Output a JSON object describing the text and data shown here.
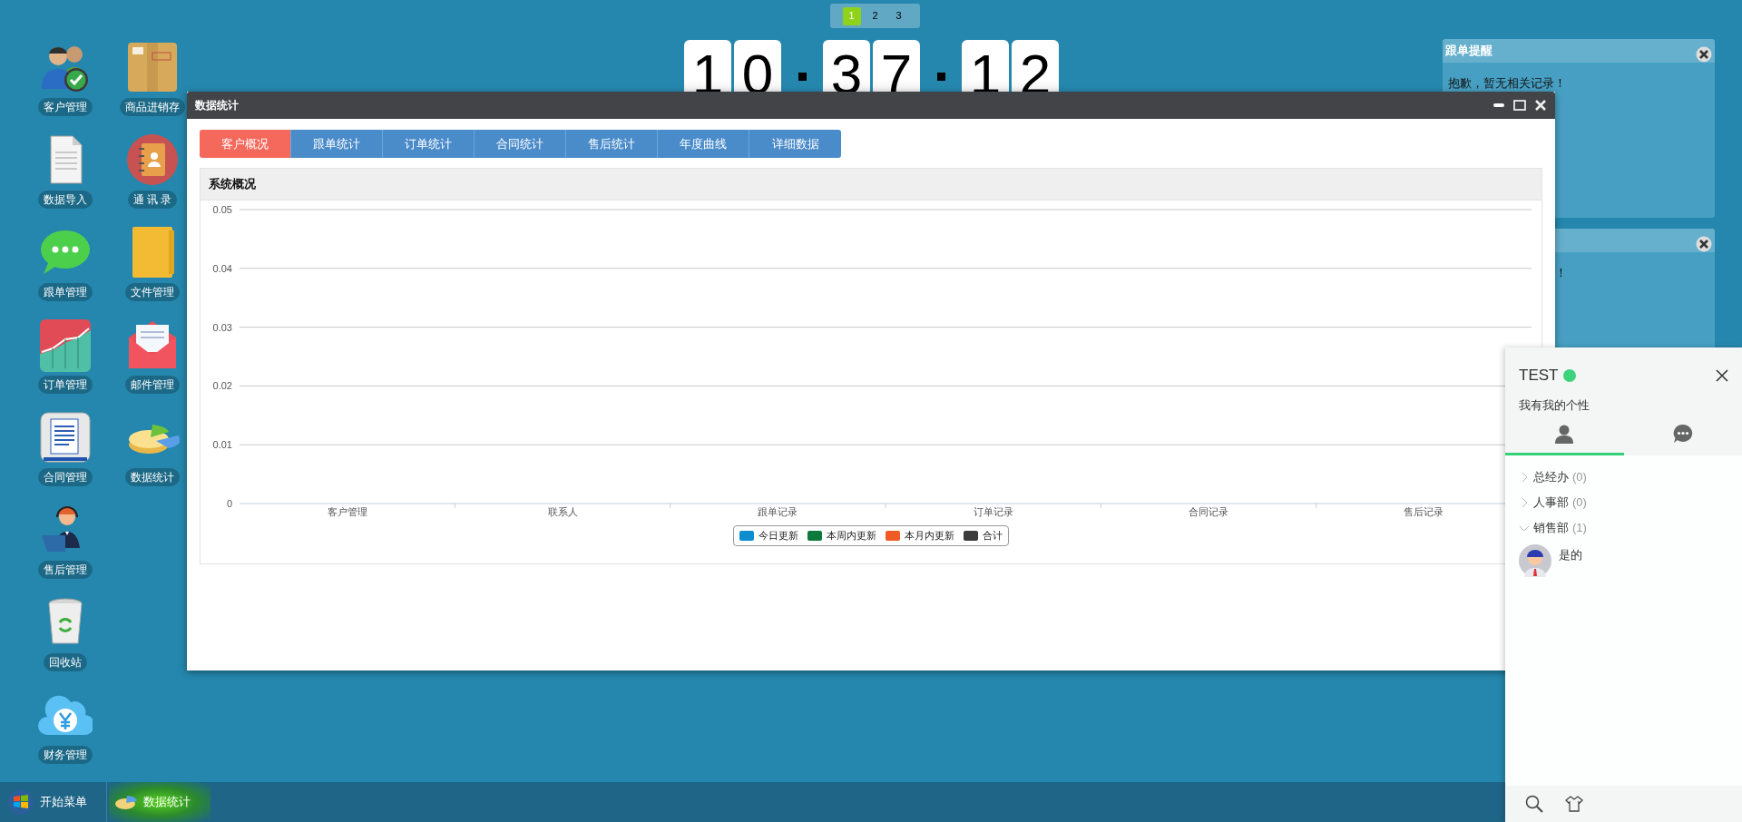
{
  "desktop_columns": [
    {
      "icons": [
        {
          "label": "客户管理"
        },
        {
          "label": "数据导入"
        },
        {
          "label": "跟单管理"
        },
        {
          "label": "订单管理"
        },
        {
          "label": "合同管理"
        },
        {
          "label": "售后管理"
        },
        {
          "label": "回收站"
        },
        {
          "label": "财务管理"
        }
      ]
    },
    {
      "icons": [
        {
          "label": "商品进销存"
        },
        {
          "label": "通 讯 录"
        },
        {
          "label": "文件管理"
        },
        {
          "label": "邮件管理"
        },
        {
          "label": "数据统计"
        }
      ]
    }
  ],
  "pager": [
    {
      "label": "1",
      "selected": true
    },
    {
      "label": "2",
      "selected": false
    },
    {
      "label": "3",
      "selected": false
    }
  ],
  "clock": {
    "digits": [
      "1",
      "0",
      "3",
      "7",
      "1",
      "2"
    ]
  },
  "window": {
    "title": "数据统计",
    "tabs": [
      {
        "label": "客户概况",
        "selected": true
      },
      {
        "label": "跟单统计",
        "selected": false
      },
      {
        "label": "订单统计",
        "selected": false
      },
      {
        "label": "合同统计",
        "selected": false
      },
      {
        "label": "售后统计",
        "selected": false
      },
      {
        "label": "年度曲线",
        "selected": false
      },
      {
        "label": "详细数据",
        "selected": false
      }
    ],
    "panel": {
      "title": "系统概况",
      "chart_data": {
        "type": "bar",
        "grid": true,
        "categories": [
          "客户管理",
          "联系人",
          "跟单记录",
          "订单记录",
          "合同记录",
          "售后记录"
        ],
        "ylim": [
          0,
          0.05
        ],
        "yticks": [
          {
            "value": 0,
            "label": "0"
          },
          {
            "value": 0.01,
            "label": "0.01"
          },
          {
            "value": 0.02,
            "label": "0.02"
          },
          {
            "value": 0.03,
            "label": "0.03"
          },
          {
            "value": 0.04,
            "label": "0.04"
          },
          {
            "value": 0.05,
            "label": "0.05"
          }
        ],
        "series": [
          {
            "name": "今日更新",
            "color": "#0e8ecf",
            "values": [
              0,
              0,
              0,
              0,
              0,
              0
            ]
          },
          {
            "name": "本周内更新",
            "color": "#0d7a3b",
            "values": [
              0,
              0,
              0,
              0,
              0,
              0
            ]
          },
          {
            "name": "本月内更新",
            "color": "#f05a24",
            "values": [
              0,
              0,
              0,
              0,
              0,
              0
            ]
          },
          {
            "name": "合计",
            "color": "#3d3b3c",
            "values": [
              0,
              0,
              0,
              0,
              0,
              0
            ]
          }
        ]
      }
    }
  },
  "reminders": [
    {
      "title": "跟单提醒",
      "message": "抱歉，暂无相关记录！"
    },
    {
      "message": "！"
    }
  ],
  "chat": {
    "name": "TEST",
    "online": true,
    "signature": "我有我的个性",
    "tabs": [
      {
        "selected": true
      },
      {
        "selected": false
      }
    ],
    "groups": [
      {
        "name": "总经办",
        "count": "(0)",
        "expanded": false
      },
      {
        "name": "人事部",
        "count": "(0)",
        "expanded": false
      },
      {
        "name": "销售部",
        "count": "(1)",
        "expanded": true,
        "children": [
          {
            "name": "是的"
          }
        ]
      }
    ]
  },
  "taskbar": {
    "start": "开始菜单",
    "tasks": [
      {
        "label": "数据统计",
        "selected": true
      }
    ]
  }
}
